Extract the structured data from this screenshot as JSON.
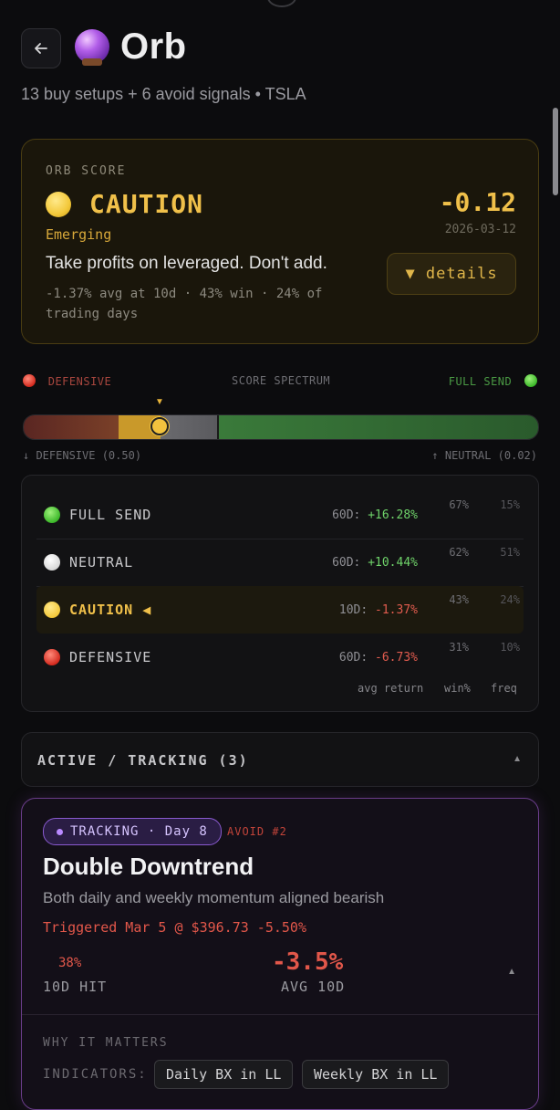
{
  "header": {
    "title": "Orb",
    "subtitle": "13 buy setups + 6 avoid signals • TSLA"
  },
  "score": {
    "label": "ORB SCORE",
    "status": "CAUTION",
    "phase": "Emerging",
    "value": "-0.12",
    "date": "2026-03-12",
    "advice": "Take profits on leveraged. Don't add.",
    "stats": "-1.37% avg at 10d · 43% win · 24% of trading days",
    "details_label": "▼ details"
  },
  "spectrum": {
    "left_label": "DEFENSIVE",
    "center_label": "SCORE SPECTRUM",
    "right_label": "FULL SEND",
    "foot_left": "↓ DEFENSIVE (0.50)",
    "foot_right": "↑ NEUTRAL (0.02)",
    "marker_arrow": "▼"
  },
  "regimes": {
    "rows": [
      {
        "name": "FULL SEND",
        "period": "60D:",
        "ret": "+16.28%",
        "win": "67%",
        "freq": "15%"
      },
      {
        "name": "NEUTRAL",
        "period": "60D:",
        "ret": "+10.44%",
        "win": "62%",
        "freq": "51%"
      },
      {
        "name": "CAUTION ◀",
        "period": "10D:",
        "ret": "-1.37%",
        "win": "43%",
        "freq": "24%"
      },
      {
        "name": "DEFENSIVE",
        "period": "60D:",
        "ret": "-6.73%",
        "win": "31%",
        "freq": "10%"
      }
    ],
    "footer": {
      "avg": "avg return",
      "win": "win%",
      "freq": "freq"
    }
  },
  "active": {
    "title": "ACTIVE / TRACKING (3)",
    "caret": "▲"
  },
  "tracking_card": {
    "pill": "TRACKING · Day 8",
    "tag": "AVOID #2",
    "name": "Double Downtrend",
    "desc": "Both daily and weekly momentum aligned bearish",
    "trigger": "Triggered Mar 5 @ $396.73  -5.50%",
    "hit_value": "38%",
    "hit_label": "10D HIT",
    "avg_value": "-3.5%",
    "avg_label": "AVG 10D",
    "caret": "▲",
    "why_label": "WHY IT MATTERS",
    "indicators_label": "INDICATORS:",
    "chips": [
      "Daily BX in LL",
      "Weekly BX in LL"
    ]
  },
  "colors": {
    "caution": "#f0c04a",
    "positive": "#6fd36a",
    "negative": "#e25c4f",
    "tracking_border": "#6a3d8a"
  },
  "icons": [
    "back-arrow-icon",
    "crystal-ball-icon",
    "yellow-circle-icon",
    "red-circle-icon",
    "green-circle-icon",
    "white-circle-icon"
  ]
}
